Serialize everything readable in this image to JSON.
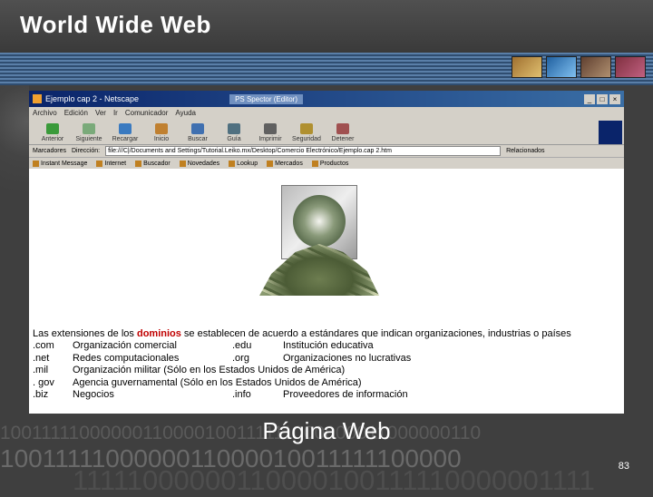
{
  "slide": {
    "title": "World Wide Web",
    "caption": "Página Web",
    "page_number": "83",
    "binary_lines": [
      "10011111000000110000100111111000000011000000110",
      "1001111100000011000010011111100000",
      "11111000000110000100111110000001111"
    ]
  },
  "browser": {
    "window_title": "Ejemplo cap 2 - Netscape",
    "taskbar_item": "PS Spector (Editor)",
    "menu": [
      "Archivo",
      "Edición",
      "Ver",
      "Ir",
      "Comunicador",
      "Ayuda"
    ],
    "toolbar": [
      {
        "label": "Anterior",
        "icon": "back-arrow-icon",
        "color": "#3a9a3a"
      },
      {
        "label": "Siguiente",
        "icon": "forward-arrow-icon",
        "color": "#7aaa7a"
      },
      {
        "label": "Recargar",
        "icon": "reload-icon",
        "color": "#3a7ac0"
      },
      {
        "label": "Inicio",
        "icon": "home-icon",
        "color": "#c08030"
      },
      {
        "label": "Buscar",
        "icon": "search-icon",
        "color": "#4070b0"
      },
      {
        "label": "Guía",
        "icon": "guide-icon",
        "color": "#507080"
      },
      {
        "label": "Imprimir",
        "icon": "print-icon",
        "color": "#606060"
      },
      {
        "label": "Seguridad",
        "icon": "lock-icon",
        "color": "#b09030"
      },
      {
        "label": "Detener",
        "icon": "stop-icon",
        "color": "#a05050"
      }
    ],
    "address": {
      "bookmarks_label": "Marcadores",
      "label": "Dirección:",
      "value": "file:///C|/Documents and Settings/Tutorial.Leiko.mx/Desktop/Comercio Electrónico/Ejemplo.cap 2.htm",
      "related_label": "Relacionados"
    },
    "links": [
      "Instant Message",
      "Internet",
      "Buscador",
      "Novedades",
      "Lookup",
      "Mercados",
      "Productos"
    ],
    "colors": {
      "titlebar": "#0a246a",
      "accent": "#c00000"
    }
  },
  "page": {
    "intro_pre": "Las extensiones de los ",
    "intro_highlight": "dominios",
    "intro_post": " se establecen de acuerdo a estándares que indican organizaciones, industrias o países",
    "domains": [
      {
        "ext1": ".com",
        "desc1": "Organización comercial",
        "ext2": ".edu",
        "desc2": "Institución educativa"
      },
      {
        "ext1": ".net",
        "desc1": "Redes computacionales",
        "ext2": ".org",
        "desc2": "Organizaciones no lucrativas"
      },
      {
        "ext1": ".mil",
        "desc1": "Organización militar (Sólo en los Estados Unidos de América)",
        "ext2": "",
        "desc2": ""
      },
      {
        "ext1": ". gov",
        "desc1": "Agencia guvernamental (Sólo en los Estados Unidos de América)",
        "ext2": "",
        "desc2": ""
      },
      {
        "ext1": ".biz",
        "desc1": "Negocios",
        "ext2": ".info",
        "desc2": "Proveedores de información"
      }
    ]
  }
}
